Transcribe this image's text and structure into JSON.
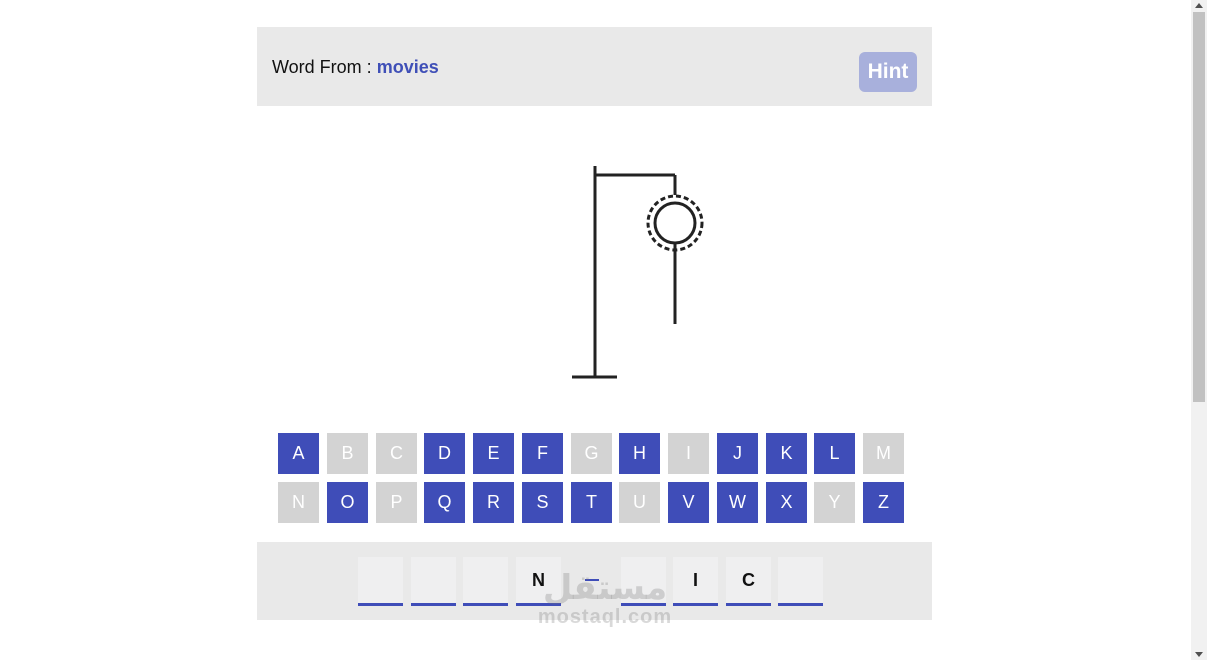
{
  "header": {
    "label": "Word From :",
    "category": "movies",
    "hint_label": "Hint"
  },
  "keyboard": {
    "rows": [
      [
        {
          "letter": "A",
          "used": false
        },
        {
          "letter": "B",
          "used": true
        },
        {
          "letter": "C",
          "used": true
        },
        {
          "letter": "D",
          "used": false
        },
        {
          "letter": "E",
          "used": false
        },
        {
          "letter": "F",
          "used": false
        },
        {
          "letter": "G",
          "used": true
        },
        {
          "letter": "H",
          "used": false
        },
        {
          "letter": "I",
          "used": true
        },
        {
          "letter": "J",
          "used": false
        },
        {
          "letter": "K",
          "used": false
        },
        {
          "letter": "L",
          "used": false
        },
        {
          "letter": "M",
          "used": true
        }
      ],
      [
        {
          "letter": "N",
          "used": true
        },
        {
          "letter": "O",
          "used": false
        },
        {
          "letter": "P",
          "used": true
        },
        {
          "letter": "Q",
          "used": false
        },
        {
          "letter": "R",
          "used": false
        },
        {
          "letter": "S",
          "used": false
        },
        {
          "letter": "T",
          "used": false
        },
        {
          "letter": "U",
          "used": true
        },
        {
          "letter": "V",
          "used": false
        },
        {
          "letter": "W",
          "used": false
        },
        {
          "letter": "X",
          "used": false
        },
        {
          "letter": "Y",
          "used": true
        },
        {
          "letter": "Z",
          "used": false
        }
      ]
    ]
  },
  "answer": {
    "slots": [
      {
        "char": "",
        "space": false
      },
      {
        "char": "",
        "space": false
      },
      {
        "char": "",
        "space": false
      },
      {
        "char": "N",
        "space": false
      },
      {
        "char": "",
        "space": true
      },
      {
        "char": "",
        "space": false
      },
      {
        "char": "I",
        "space": false
      },
      {
        "char": "C",
        "space": false
      },
      {
        "char": "",
        "space": false
      }
    ]
  },
  "watermark": {
    "arabic": "مستقل",
    "latin": "mostaql.com"
  },
  "colors": {
    "accent": "#3f4db8",
    "used_key": "#d3d3d3",
    "panel": "#e9e9e9",
    "hint": "#a8b0dc"
  }
}
